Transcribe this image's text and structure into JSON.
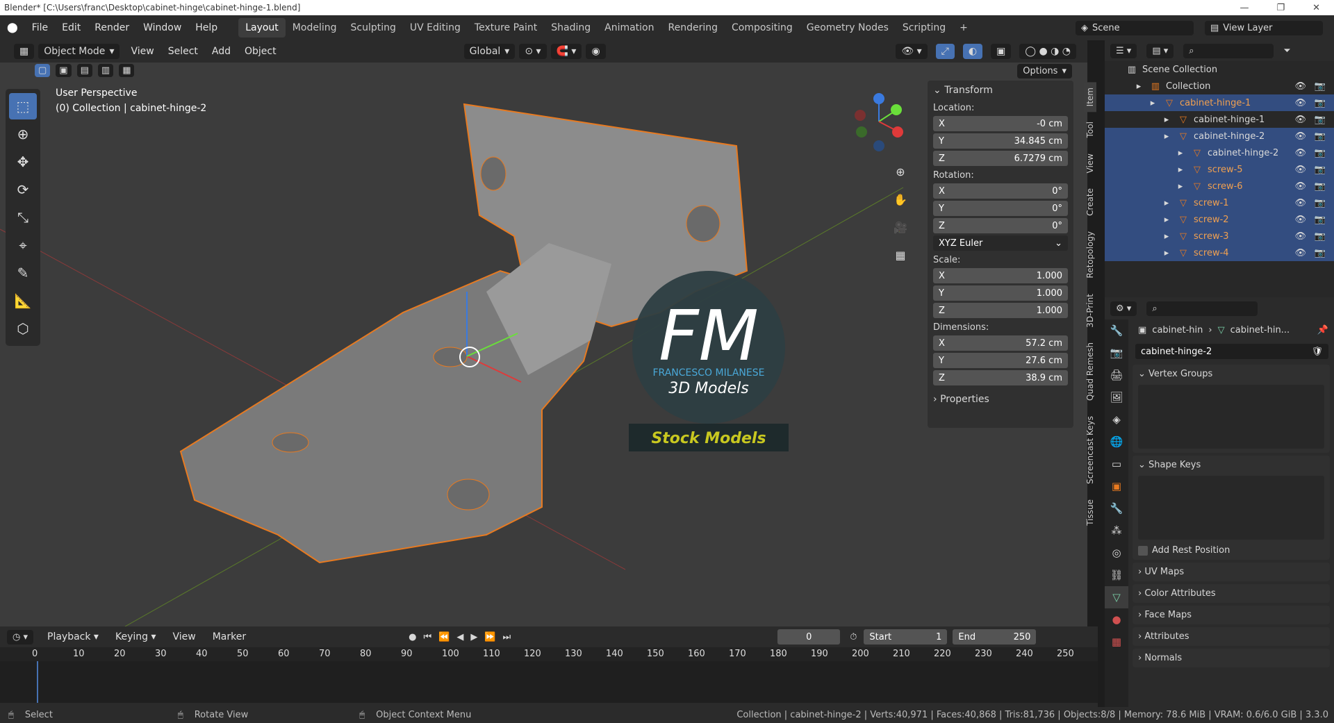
{
  "titlebar": {
    "title": "Blender* [C:\\Users\\franc\\Desktop\\cabinet-hinge\\cabinet-hinge-1.blend]"
  },
  "menu": [
    "File",
    "Edit",
    "Render",
    "Window",
    "Help"
  ],
  "workspaces": [
    "Layout",
    "Modeling",
    "Sculpting",
    "UV Editing",
    "Texture Paint",
    "Shading",
    "Animation",
    "Rendering",
    "Compositing",
    "Geometry Nodes",
    "Scripting"
  ],
  "scene": {
    "label": "Scene",
    "viewlayer": "View Layer"
  },
  "viewport_header": {
    "mode": "Object Mode",
    "view": "View",
    "select": "Select",
    "add": "Add",
    "object": "Object",
    "orientation": "Global",
    "options": "Options"
  },
  "overlay_text": {
    "perspective": "User Perspective",
    "collection": "(0) Collection | cabinet-hinge-2"
  },
  "watermark": {
    "logo": "FM",
    "name": "FRANCESCO MILANESE",
    "sub": "3D Models",
    "stock": "Stock Models"
  },
  "transform": {
    "title": "Transform",
    "location": "Location:",
    "loc": {
      "x": "-0 cm",
      "y": "34.845 cm",
      "z": "6.7279 cm"
    },
    "rotation": "Rotation:",
    "rot": {
      "x": "0°",
      "y": "0°",
      "z": "0°"
    },
    "euler": "XYZ Euler",
    "scale": "Scale:",
    "sc": {
      "x": "1.000",
      "y": "1.000",
      "z": "1.000"
    },
    "dimensions": "Dimensions:",
    "dim": {
      "x": "57.2 cm",
      "y": "27.6 cm",
      "z": "38.9 cm"
    },
    "properties": "Properties"
  },
  "vtabs": [
    "Item",
    "Tool",
    "View",
    "Create",
    "Retopology",
    "3D-Print",
    "Quad Remesh",
    "Screencast Keys",
    "Tissue"
  ],
  "outliner": {
    "scene_collection": "Scene Collection",
    "items": [
      {
        "label": "Collection",
        "indent": 1,
        "sel": false,
        "orange": false
      },
      {
        "label": "cabinet-hinge-1",
        "indent": 2,
        "sel": true,
        "orange": true
      },
      {
        "label": "cabinet-hinge-1",
        "indent": 3,
        "sel": false,
        "orange": false
      },
      {
        "label": "cabinet-hinge-2",
        "indent": 3,
        "sel": true,
        "orange": false
      },
      {
        "label": "cabinet-hinge-2",
        "indent": 4,
        "sel": true,
        "orange": false
      },
      {
        "label": "screw-5",
        "indent": 4,
        "sel": true,
        "orange": true
      },
      {
        "label": "screw-6",
        "indent": 4,
        "sel": true,
        "orange": true
      },
      {
        "label": "screw-1",
        "indent": 3,
        "sel": true,
        "orange": true
      },
      {
        "label": "screw-2",
        "indent": 3,
        "sel": true,
        "orange": true
      },
      {
        "label": "screw-3",
        "indent": 3,
        "sel": true,
        "orange": true
      },
      {
        "label": "screw-4",
        "indent": 3,
        "sel": true,
        "orange": true
      }
    ]
  },
  "props": {
    "crumb1": "cabinet-hin",
    "crumb2": "cabinet-hin...",
    "mesh": "cabinet-hinge-2",
    "vertex_groups": "Vertex Groups",
    "shape_keys": "Shape Keys",
    "rest": "Add Rest Position",
    "sections": [
      "UV Maps",
      "Color Attributes",
      "Face Maps",
      "Attributes",
      "Normals"
    ]
  },
  "timeline": {
    "playback": "Playback",
    "keying": "Keying",
    "view": "View",
    "marker": "Marker",
    "frame": "0",
    "start_label": "Start",
    "start": "1",
    "end_label": "End",
    "end": "250",
    "ticks": [
      "0",
      "10",
      "20",
      "30",
      "40",
      "50",
      "60",
      "70",
      "80",
      "90",
      "100",
      "110",
      "120",
      "130",
      "140",
      "150",
      "160",
      "170",
      "180",
      "190",
      "200",
      "210",
      "220",
      "230",
      "240",
      "250"
    ]
  },
  "status": {
    "select": "Select",
    "rotate": "Rotate View",
    "context": "Object Context Menu",
    "info": "Collection | cabinet-hinge-2 | Verts:40,971 | Faces:40,868 | Tris:81,736 | Objects:8/8 | Memory: 78.6 MiB | VRAM: 0.6/6.0 GiB | 3.3.0"
  }
}
